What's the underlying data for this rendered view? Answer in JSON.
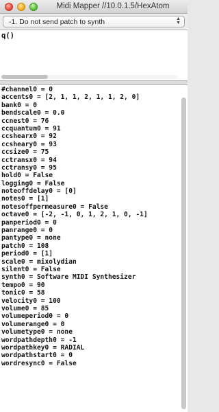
{
  "window": {
    "title": "Midi Mapper //10.0.1.5/HexAtom",
    "controls": [
      "close",
      "minimize",
      "zoom"
    ]
  },
  "dropdown": {
    "selected": "-1. Do not send patch to synth",
    "arrow_icon": "updown-arrows-icon"
  },
  "editor": {
    "text": "q()"
  },
  "output": {
    "lines": [
      "#channel0 = 0",
      "accents0 = [2, 1, 1, 2, 1, 1, 2, 0]",
      "bank0 = 0",
      "bendscale0 = 0.0",
      "ccnest0 = 76",
      "ccquantum0 = 91",
      "ccshearx0 = 92",
      "ccsheary0 = 93",
      "ccsize0 = 75",
      "cctransx0 = 94",
      "cctransy0 = 95",
      "hold0 = False",
      "logging0 = False",
      "noteoffdelay0 = [0]",
      "notes0 = [1]",
      "notesoffpermeasure0 = False",
      "octave0 = [-2, -1, 0, 1, 2, 1, 0, -1]",
      "panperiod0 = 0",
      "panrange0 = 0",
      "pantype0 = none",
      "patch0 = 108",
      "period0 = [1]",
      "scale0 = mixolydian",
      "silent0 = False",
      "synth0 = Software MIDI Synthesizer",
      "tempo0 = 90",
      "tonic0 = 58",
      "velocity0 = 100",
      "volume0 = 85",
      "volumeperiod0 = 0",
      "volumerange0 = 0",
      "volumetype0 = none",
      "wordpathdepth0 = -1",
      "wordpathkey0 = RADIAL",
      "wordpathstart0 = 0",
      "wordresync0 = False"
    ]
  }
}
